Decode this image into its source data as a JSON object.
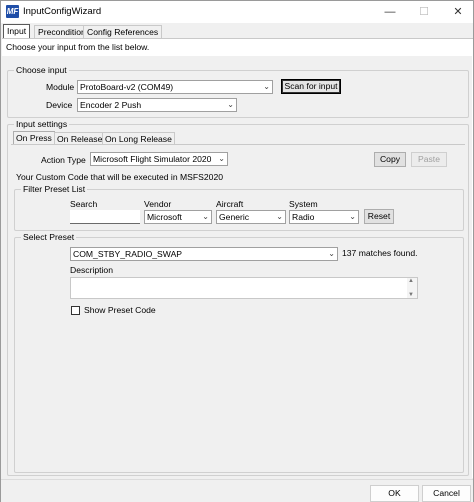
{
  "window": {
    "title": "InputConfigWizard",
    "icon_text": "MF"
  },
  "tabs": [
    {
      "label": "Input"
    },
    {
      "label": "Precondition"
    },
    {
      "label": "Config References"
    }
  ],
  "instruction": "Choose your input from the list below.",
  "choose_input": {
    "legend": "Choose input",
    "module_label": "Module",
    "module_value": "ProtoBoard-v2 (COM49)",
    "scan_button": "Scan for input",
    "device_label": "Device",
    "device_value": "Encoder 2 Push"
  },
  "input_settings": {
    "legend": "Input settings",
    "tabs": [
      {
        "label": "On Press"
      },
      {
        "label": "On Release"
      },
      {
        "label": "On Long Release"
      }
    ],
    "action_type_label": "Action Type",
    "action_type_value": "Microsoft Flight Simulator 2020",
    "copy_button": "Copy",
    "paste_button": "Paste",
    "custom_code_note": "Your Custom Code that will be executed in MSFS2020"
  },
  "filter": {
    "legend": "Filter Preset List",
    "search_label": "Search",
    "search_value": "",
    "vendor_label": "Vendor",
    "vendor_value": "Microsoft",
    "aircraft_label": "Aircraft",
    "aircraft_value": "Generic",
    "system_label": "System",
    "system_value": "Radio",
    "reset_button": "Reset"
  },
  "select_preset": {
    "legend": "Select Preset",
    "preset_value": "COM_STBY_RADIO_SWAP",
    "matches": "137 matches found.",
    "description_label": "Description",
    "description_value": "",
    "show_code_label": "Show Preset Code",
    "show_code_checked": false
  },
  "footer": {
    "ok": "OK",
    "cancel": "Cancel"
  }
}
